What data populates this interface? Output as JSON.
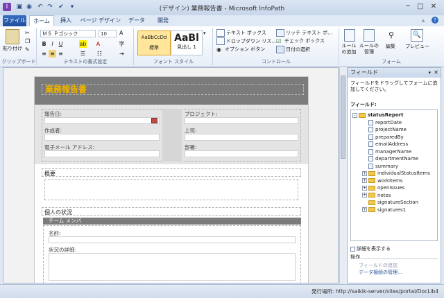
{
  "window": {
    "title": "(デザイン) 業務報告書 - Microsoft InfoPath"
  },
  "tabs": [
    "ファイル",
    "ホーム",
    "挿入",
    "ページ デザイン",
    "データ",
    "開発"
  ],
  "ribbon": {
    "clipboard": {
      "paste": "貼り付け",
      "label": "クリップボード"
    },
    "font": {
      "font_name": "ＭＳ Ｐゴシック",
      "font_size": "10",
      "label": "テキストの書式設定"
    },
    "styles": {
      "normal_preview": "AaBbCcDd",
      "normal_label": "標準",
      "heading_preview": "AaBl",
      "heading_label": "見出し 1",
      "label": "フォント スタイル"
    },
    "controls": {
      "items": [
        "テキスト ボックス",
        "リッチ テキスト ボ...",
        "ドロップダウン リス...",
        "チェック ボックス",
        "オプション ボタン",
        "日付の選択"
      ],
      "label": "コントロール"
    },
    "rules": {
      "add_rule": "ルールの追加",
      "manage_rules": "ルールの管理",
      "edit": "編集",
      "preview": "プレビュー",
      "label": "フォーム"
    }
  },
  "form": {
    "title": "業務報告書",
    "fields": {
      "report_date": "報告日:",
      "project": "プロジェクト:",
      "prepared_by": "作成者:",
      "manager": "上司:",
      "email": "電子メール アドレス:",
      "department": "部署:"
    },
    "summary_label": "概要",
    "status_label": "個人の状況",
    "team_member": "チーム メンバ",
    "name_label": "名前:",
    "status_detail": "状況の詳細:"
  },
  "pane": {
    "title": "フィールド",
    "instruction": "フィールドをドラッグしてフォームに追加してください。",
    "fields_label": "フィールド:",
    "tree": [
      {
        "name": "statusReport",
        "type": "folder",
        "level": 0,
        "expand": "-",
        "bold": true
      },
      {
        "name": "reportDate",
        "type": "field",
        "level": 1
      },
      {
        "name": "projectName",
        "type": "field",
        "level": 1
      },
      {
        "name": "preparedBy",
        "type": "field",
        "level": 1
      },
      {
        "name": "emailAddress",
        "type": "field",
        "level": 1
      },
      {
        "name": "managerName",
        "type": "field",
        "level": 1
      },
      {
        "name": "departmentName",
        "type": "field",
        "level": 1
      },
      {
        "name": "summary",
        "type": "field",
        "level": 1
      },
      {
        "name": "individualStatusItems",
        "type": "folder",
        "level": 1,
        "expand": "+"
      },
      {
        "name": "workItems",
        "type": "folder",
        "level": 1,
        "expand": "+"
      },
      {
        "name": "openIssues",
        "type": "folder",
        "level": 1,
        "expand": "+"
      },
      {
        "name": "notes",
        "type": "folder",
        "level": 1,
        "expand": "+"
      },
      {
        "name": "signatureSection",
        "type": "folder",
        "level": 1
      },
      {
        "name": "signatures1",
        "type": "folder",
        "level": 1,
        "expand": "+"
      }
    ],
    "show_details": "詳細を表示する",
    "actions_label": "操作",
    "add_field": "フィールドの追加",
    "manage_data": "データ接続の管理..."
  },
  "status": {
    "publish_location": "発行場所: http://saikik-server/sites/portal/DocLib4"
  },
  "colors": {
    "file_tab": "#2b579a",
    "title_text": "#f0b400",
    "header_bg": "#7b7b7b"
  }
}
